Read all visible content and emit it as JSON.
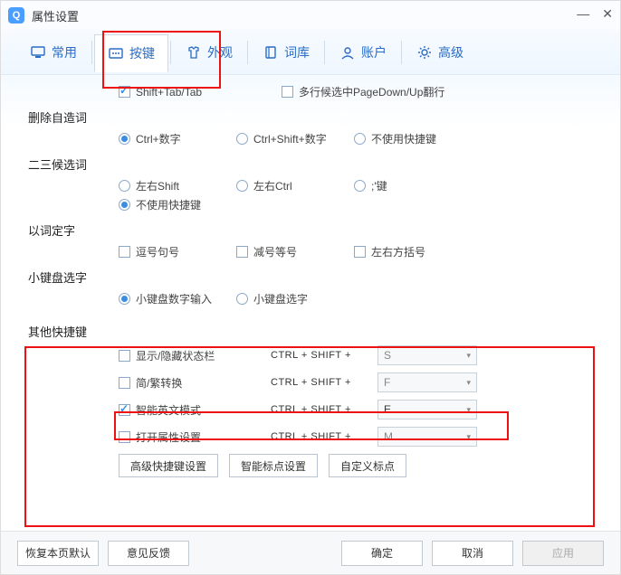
{
  "window": {
    "title": "属性设置"
  },
  "tabs": {
    "items": [
      {
        "label": "常用"
      },
      {
        "label": "按键"
      },
      {
        "label": "外观"
      },
      {
        "label": "词库"
      },
      {
        "label": "账户"
      },
      {
        "label": "高级"
      }
    ]
  },
  "partial": {
    "cb1_label": "Shift+Tab/Tab",
    "cb2_label": "多行候选中PageDown/Up翻行"
  },
  "sec_delete": {
    "title": "删除自造词",
    "r1": "Ctrl+数字",
    "r2": "Ctrl+Shift+数字",
    "r3": "不使用快捷键"
  },
  "sec_23": {
    "title": "二三候选词",
    "r1": "左右Shift",
    "r2": "左右Ctrl",
    "r3": ";'键",
    "r4": "不使用快捷键"
  },
  "sec_word": {
    "title": "以词定字",
    "c1": "逗号句号",
    "c2": "减号等号",
    "c3": "左右方括号"
  },
  "sec_numpad": {
    "title": "小键盘选字",
    "r1": "小键盘数字输入",
    "r2": "小键盘选字"
  },
  "sec_other": {
    "title": "其他快捷键",
    "h1": {
      "label": "显示/隐藏状态栏",
      "prefix": "CTRL + SHIFT +",
      "key": "S"
    },
    "h2": {
      "label": "简/繁转换",
      "prefix": "CTRL + SHIFT +",
      "key": "F"
    },
    "h3": {
      "label": "智能英文模式",
      "prefix": "CTRL + SHIFT +",
      "key": "E"
    },
    "h4": {
      "label": "打开属性设置",
      "prefix": "CTRL + SHIFT +",
      "key": "M"
    },
    "btn1": "高级快捷键设置",
    "btn2": "智能标点设置",
    "btn3": "自定义标点"
  },
  "footer": {
    "restore": "恢复本页默认",
    "feedback": "意见反馈",
    "ok": "确定",
    "cancel": "取消",
    "apply": "应用"
  }
}
